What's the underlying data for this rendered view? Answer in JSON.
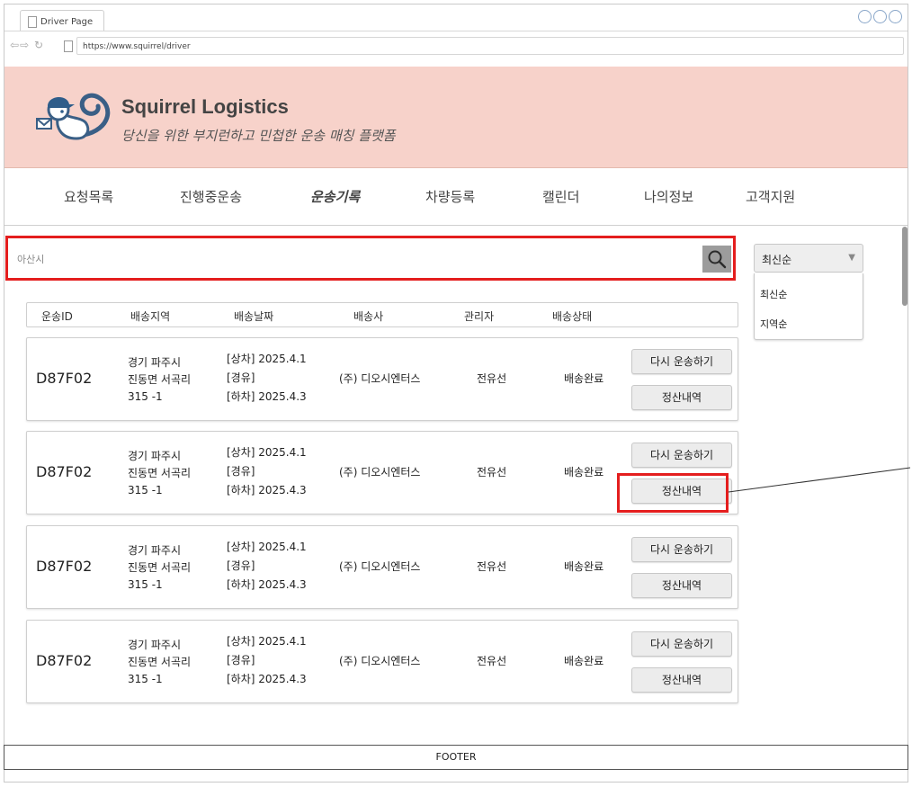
{
  "browser": {
    "tab_title": "Driver Page",
    "url": "https://www.squirrel/driver"
  },
  "header": {
    "brand": "Squirrel Logistics",
    "tagline": "당신을 위한 부지런하고 민첩한 운송 매칭 플랫폼"
  },
  "nav": {
    "items": [
      {
        "label": "요청목록"
      },
      {
        "label": "진행중운송"
      },
      {
        "label": "운송기록",
        "active": true
      },
      {
        "label": "차량등록"
      },
      {
        "label": "캘린더"
      },
      {
        "label": "나의정보"
      },
      {
        "label": "고객지원"
      }
    ]
  },
  "search": {
    "value": "아산시",
    "icon": "search-icon"
  },
  "sort": {
    "selected": "최신순",
    "options": [
      "최신순",
      "지역순"
    ]
  },
  "table": {
    "headers": [
      "운송ID",
      "배송지역",
      "배송날짜",
      "배송사",
      "관리자",
      "배송상태"
    ],
    "rows": [
      {
        "id": "D87F02",
        "region1": "경기 파주시",
        "region2": "진동면 서곡리",
        "region3": "315 -1",
        "load": "[상차] 2025.4.1",
        "via": "[경유]",
        "unload": "[하차] 2025.4.3",
        "carrier": "(주) 디오시엔터스",
        "manager": "전유선",
        "status": "배송완료",
        "rerun": "다시 운송하기",
        "settle": "정산내역"
      },
      {
        "id": "D87F02",
        "region1": "경기 파주시",
        "region2": "진동면 서곡리",
        "region3": "315 -1",
        "load": "[상차] 2025.4.1",
        "via": "[경유]",
        "unload": "[하차] 2025.4.3",
        "carrier": "(주) 디오시엔터스",
        "manager": "전유선",
        "status": "배송완료",
        "rerun": "다시 운송하기",
        "settle": "정산내역"
      },
      {
        "id": "D87F02",
        "region1": "경기 파주시",
        "region2": "진동면 서곡리",
        "region3": "315 -1",
        "load": "[상차] 2025.4.1",
        "via": "[경유]",
        "unload": "[하차] 2025.4.3",
        "carrier": "(주) 디오시엔터스",
        "manager": "전유선",
        "status": "배송완료",
        "rerun": "다시 운송하기",
        "settle": "정산내역"
      },
      {
        "id": "D87F02",
        "region1": "경기 파주시",
        "region2": "진동면 서곡리",
        "region3": "315 -1",
        "load": "[상차] 2025.4.1",
        "via": "[경유]",
        "unload": "[하차] 2025.4.3",
        "carrier": "(주) 디오시엔터스",
        "manager": "전유선",
        "status": "배송완료",
        "rerun": "다시 운송하기",
        "settle": "정산내역"
      }
    ]
  },
  "footer": {
    "label": "FOOTER"
  },
  "colors": {
    "header_bg": "#f7d2ca",
    "highlight": "#e41e1e",
    "button_bg": "#ececec"
  }
}
